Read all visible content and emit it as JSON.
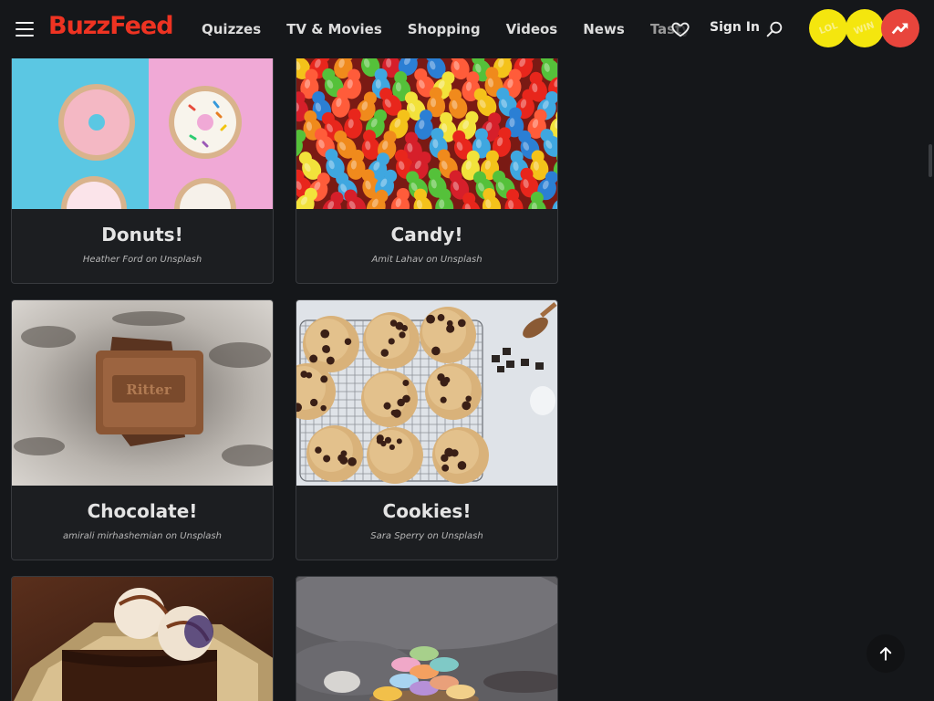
{
  "header": {
    "logo": "BuzzFeed",
    "nav": [
      "Quizzes",
      "TV & Movies",
      "Shopping",
      "Videos",
      "News",
      "Tasty"
    ],
    "sign_in": "Sign In",
    "badges": [
      "LOL",
      "WIN",
      "trending-icon"
    ],
    "colors": {
      "brand": "#ee3322",
      "badge_yellow": "#f4e60e",
      "badge_red": "#e8453c"
    }
  },
  "cards": [
    {
      "title": "Donuts!",
      "credit_name": "Heather Ford",
      "credit_on": "on",
      "credit_source": "Unsplash"
    },
    {
      "title": "Candy!",
      "credit_name": "Amit Lahav",
      "credit_on": "on",
      "credit_source": "Unsplash"
    },
    {
      "title": "Chocolate!",
      "credit_name": "amirali mirhashemian",
      "credit_on": "on",
      "credit_source": "Unsplash"
    },
    {
      "title": "Cookies!",
      "credit_name": "Sara Sperry",
      "credit_on": "on",
      "credit_source": "Unsplash"
    },
    {
      "title": "",
      "credit_name": "",
      "credit_on": "",
      "credit_source": ""
    },
    {
      "title": "",
      "credit_name": "",
      "credit_on": "",
      "credit_source": ""
    }
  ],
  "back_to_top_icon": "arrow-up-icon"
}
